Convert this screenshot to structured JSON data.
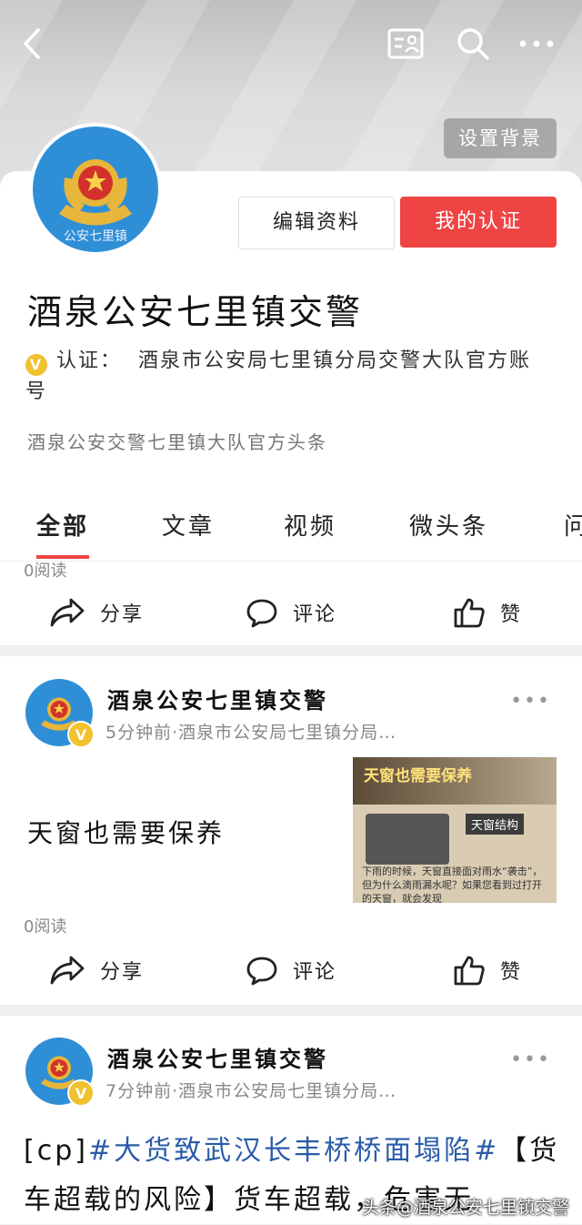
{
  "header": {
    "set_background": "设置背景"
  },
  "profile": {
    "avatar_text": "公安七里镇",
    "edit_button": "编辑资料",
    "cert_button": "我的认证",
    "name": "酒泉公安七里镇交警",
    "cert_label": "认证：",
    "cert_value": "酒泉市公安局七里镇分局交警大队官方账号",
    "verified_mark": "V",
    "description": "酒泉公安交警七里镇大队官方头条"
  },
  "tabs": [
    {
      "label": "全部",
      "active": true
    },
    {
      "label": "文章"
    },
    {
      "label": "视频"
    },
    {
      "label": "微头条"
    },
    {
      "label": "问"
    }
  ],
  "actions": {
    "share": "分享",
    "comment": "评论",
    "like": "赞"
  },
  "posts": [
    {
      "reads": "0阅读"
    },
    {
      "author": "酒泉公安七里镇交警",
      "meta": "5分钟前·酒泉市公安局七里镇分局…",
      "title": "天窗也需要保养",
      "reads": "0阅读",
      "thumb_heading": "天窗也需要保养",
      "thumb_label": "天窗结构",
      "thumb_caption": "下雨的时候，天窗直接面对雨水“袭击”，但为什么滴雨漏水呢？如果您看到过打开的天窗，就会发现"
    },
    {
      "author": "酒泉公安七里镇交警",
      "meta": "7分钟前·酒泉市公安局七里镇分局…",
      "text_prefix": "[cp]",
      "hashtag": "#大货致武汉长丰桥桥面塌陷#",
      "text_rest": "【货车超载的风险】货车超载，危害无"
    }
  ],
  "more_glyph": "•••",
  "watermark": "头条@酒泉公安七里镇交警",
  "colors": {
    "accent_red": "#ef4444",
    "verified_yellow": "#f2c12e",
    "hashtag_blue": "#2a5ca8"
  }
}
